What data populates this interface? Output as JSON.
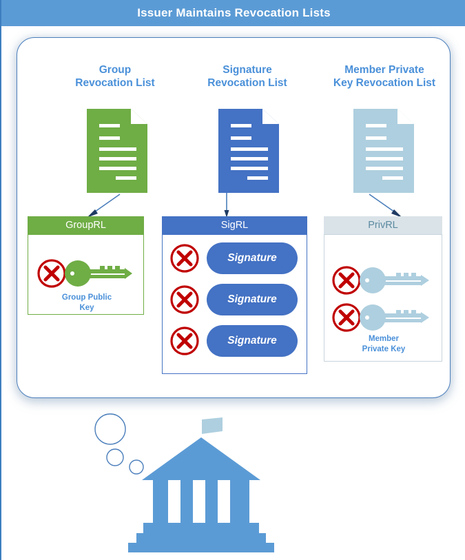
{
  "title": {
    "text": "Issuer Maintains Revocation Lists"
  },
  "colors": {
    "title_bar": "#5b9bd5",
    "panel_border": "#4a7ebb",
    "heading_blue": "#4a90d9",
    "green": "#6fad45",
    "blue": "#4472c4",
    "light_blue": "#aecfdf",
    "priv_header_bg": "#dae3e8",
    "priv_header_text": "#5b8aa0",
    "red": "#c00000",
    "bank_blue": "#5b9bd5"
  },
  "columns": [
    {
      "id": "group",
      "heading_line1": "Group",
      "heading_line2": "Revocation List",
      "doc_icon": "document-icon",
      "doc_color": "#6fad45",
      "arrow_icon": "arrow-down-left-icon",
      "box_label": "GroupRL",
      "items": [
        {
          "revoked_icon": "red-x-circle-icon",
          "subject_icon": "key-icon",
          "subject_color": "#6fad45"
        }
      ],
      "caption_line1": "Group Public",
      "caption_line2": "Key"
    },
    {
      "id": "signature",
      "heading_line1": "Signature",
      "heading_line2": "Revocation List",
      "doc_icon": "document-icon",
      "doc_color": "#4472c4",
      "arrow_icon": "arrow-down-icon",
      "box_label": "SigRL",
      "items": [
        {
          "revoked_icon": "red-x-circle-icon",
          "label": "Signature"
        },
        {
          "revoked_icon": "red-x-circle-icon",
          "label": "Signature"
        },
        {
          "revoked_icon": "red-x-circle-icon",
          "label": "Signature"
        }
      ],
      "caption_line1": "",
      "caption_line2": ""
    },
    {
      "id": "private_key",
      "heading_line1": "Member Private",
      "heading_line2": "Key Revocation List",
      "doc_icon": "document-icon",
      "doc_color": "#aecfdf",
      "arrow_icon": "arrow-down-right-icon",
      "box_label": "PrivRL",
      "items": [
        {
          "revoked_icon": "red-x-circle-icon",
          "subject_icon": "key-icon",
          "subject_color": "#aecfdf"
        },
        {
          "revoked_icon": "red-x-circle-icon",
          "subject_icon": "key-icon",
          "subject_color": "#aecfdf"
        }
      ],
      "caption_line1": "Member",
      "caption_line2": "Private Key"
    }
  ],
  "illustration": {
    "name": "issuer-bank-illustration",
    "icon": "bank-building-icon",
    "flag_icon": "flag-icon",
    "thought_bubbles": 3
  }
}
